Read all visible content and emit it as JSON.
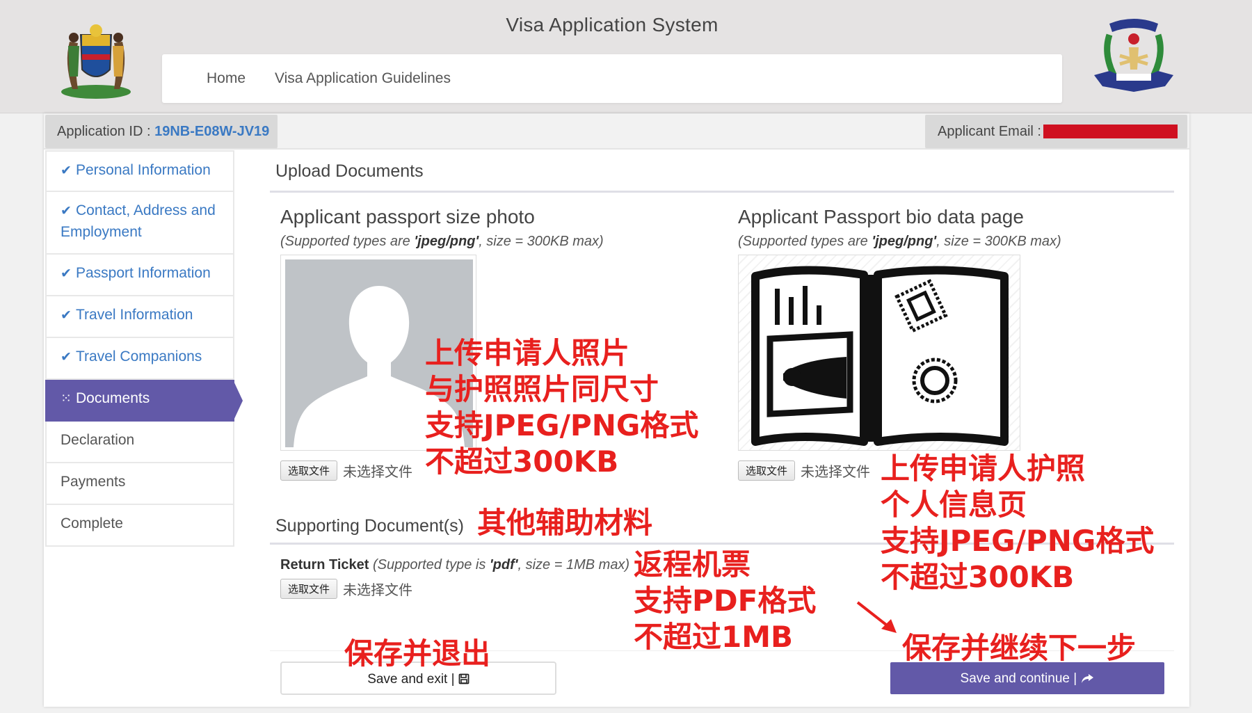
{
  "header": {
    "title": "Visa Application System",
    "nav": {
      "home": "Home",
      "guidelines": "Visa Application Guidelines"
    }
  },
  "info_bar": {
    "app_id_label": "Application ID : ",
    "app_id_value": "19NB-E08W-JV19",
    "email_label": "Applicant Email : "
  },
  "sidebar": {
    "items": [
      {
        "label": "Personal Information",
        "done": true
      },
      {
        "label": "Contact, Address and Employment",
        "done": true
      },
      {
        "label": "Passport Information",
        "done": true
      },
      {
        "label": "Travel Information",
        "done": true
      },
      {
        "label": "Travel Companions",
        "done": true
      },
      {
        "label": "Documents",
        "active": true
      },
      {
        "label": "Declaration"
      },
      {
        "label": "Payments"
      },
      {
        "label": "Complete"
      }
    ]
  },
  "main": {
    "section_title": "Upload Documents",
    "photo": {
      "title": "Applicant passport size photo",
      "hint_pre": "(Supported types are ",
      "hint_types": "'jpeg/png'",
      "hint_post": ", size = 300KB max)"
    },
    "passport": {
      "title": "Applicant Passport bio data page",
      "hint_pre": "(Supported types are ",
      "hint_types": "'jpeg/png'",
      "hint_post": ", size = 300KB max)"
    },
    "file_button": "选取文件",
    "file_status": "未选择文件",
    "supporting_title": "Supporting Document(s)",
    "ticket": {
      "label": "Return Ticket",
      "hint_pre": " (Supported type is ",
      "hint_type": "'pdf'",
      "hint_post": ", size = 1MB max)"
    },
    "save_exit": "Save and exit | ",
    "save_continue": "Save and continue | "
  },
  "annotations": {
    "photo": [
      "上传申请人照片",
      "与护照照片同尺寸",
      "支持JPEG/PNG格式",
      "不超过300KB"
    ],
    "passport": [
      "上传申请人护照",
      "个人信息页",
      "支持JPEG/PNG格式",
      "不超过300KB"
    ],
    "supporting": "其他辅助材料",
    "ticket": [
      "返程机票",
      "支持PDF格式",
      "不超过1MB"
    ],
    "save_exit": "保存并退出",
    "save_continue": "保存并继续下一步"
  },
  "colors": {
    "accent": "#6259a8",
    "link": "#3a79c3",
    "annotation": "#e8201e",
    "redaction": "#cf1020"
  }
}
